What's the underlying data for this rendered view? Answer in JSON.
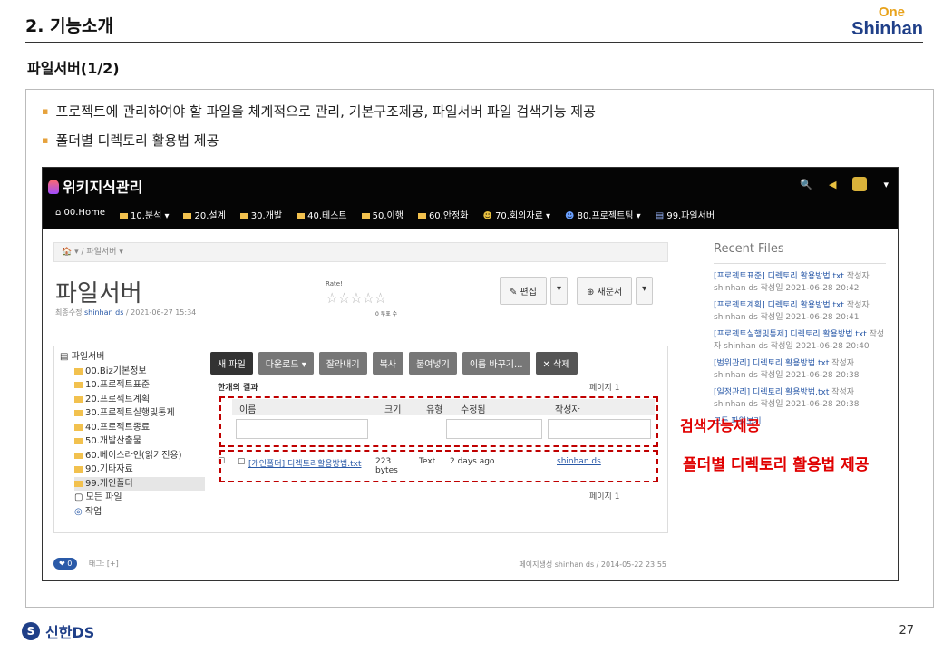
{
  "slide": {
    "title": "2. 기능소개",
    "subtitle": "파일서버(1/2)",
    "logo_top": "One",
    "logo_bottom": "Shinhan",
    "bullets": [
      "프로젝트에 관리하여야 할 파일을 체계적으로 관리, 기본구조제공, 파일서버 파일 검색기능 제공",
      "폴더별 디렉토리 활용법 제공"
    ],
    "footer_logo": "신한DS",
    "page_number": "27"
  },
  "app": {
    "brand": "위키지식관리",
    "menu": [
      "00.Home",
      "10.분석 ▾",
      "20.설계",
      "30.개발",
      "40.테스트",
      "50.이행",
      "60.안정화",
      "70.회의자료 ▾",
      "80.프로젝트팀 ▾",
      "99.파일서버"
    ],
    "breadcrumb": "🏠 ▾ / 파일서버 ▾",
    "page_title": "파일서버",
    "meta_prefix": "최종수정",
    "meta_user": "shinhan ds",
    "meta_date": "/ 2021-06-27 15:34",
    "rate_label": "Rate!",
    "stars": "☆☆☆☆☆",
    "rate_count": "0 투표 수",
    "edit_button": "✎ 편집",
    "new_doc_button": "⊕ 새문서",
    "tree": [
      "파일서버",
      "00.Biz기본정보",
      "10.프로젝트표준",
      "20.프로젝트계획",
      "30.프로젝트실행및통제",
      "40.프로젝트종료",
      "50.개발산출물",
      "60.베이스라인(읽기전용)",
      "90.기타자료",
      "99.개인폴더",
      "모든 파일",
      "작업"
    ],
    "toolbar": [
      "새 파일",
      "다운로드 ▾",
      "잘라내기",
      "복사",
      "붙여넣기",
      "이름 바꾸기...",
      "✕ 삭제"
    ],
    "results_label": "한개의 결과",
    "page_label": "페이지 1",
    "columns": [
      "이름",
      "크기",
      "유형",
      "수정됨",
      "작성자"
    ],
    "row": {
      "name": "[개인폴더] 디렉토리활용방법.txt",
      "size": "223 bytes",
      "type": "Text",
      "modified": "2 days ago",
      "author": "shinhan ds"
    },
    "recent_title": "Recent Files",
    "recent": [
      {
        "link": "[프로젝트표준] 디렉토리 활용방법.txt",
        "meta": "작성자 shinhan ds 작성일 2021-06-28 20:42"
      },
      {
        "link": "[프로젝트계획] 디렉토리 활용방법.txt",
        "meta": "작성자 shinhan ds 작성일 2021-06-28 20:41"
      },
      {
        "link": "[프로젝트실행및통제] 디렉토리 활용방법.txt",
        "meta": "작성자 shinhan ds 작성일 2021-06-28 20:40"
      },
      {
        "link": "[범위관리] 디렉토리 활용방법.txt",
        "meta": "작성자 shinhan ds 작성일 2021-06-28 20:38"
      },
      {
        "link": "[일정관리] 디렉토리 활용방법.txt",
        "meta": "작성자 shinhan ds 작성일 2021-06-28 20:38"
      }
    ],
    "all_files_link": "모든 파일보기",
    "tags_label": "태그: [+]",
    "footer_meta": "페이지생성 shinhan ds / 2014-05-22 23:55"
  },
  "annotations": {
    "search": "검색기능제공",
    "directory": "폴더별 디렉토리 활용법 제공"
  }
}
